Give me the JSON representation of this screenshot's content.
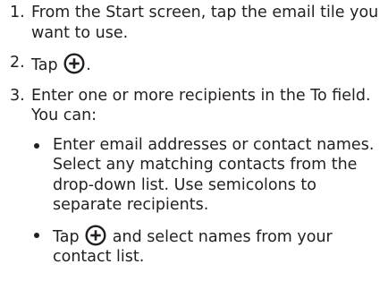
{
  "steps": [
    {
      "number": "1.",
      "text": "From the Start screen, tap the email tile you want to use."
    },
    {
      "number": "2.",
      "text_before": "Tap ",
      "icon": "plus-circle-icon",
      "text_after": "."
    },
    {
      "number": "3.",
      "text": "Enter one or more recipients in the To field. You can:",
      "bullets": [
        {
          "text": "Enter email addresses or contact names. Select any matching contacts from the drop-down list. Use semicolons to separate recipients."
        },
        {
          "text_before": "Tap ",
          "icon": "plus-circle-icon",
          "text_after": " and select names from your contact list."
        }
      ]
    }
  ]
}
